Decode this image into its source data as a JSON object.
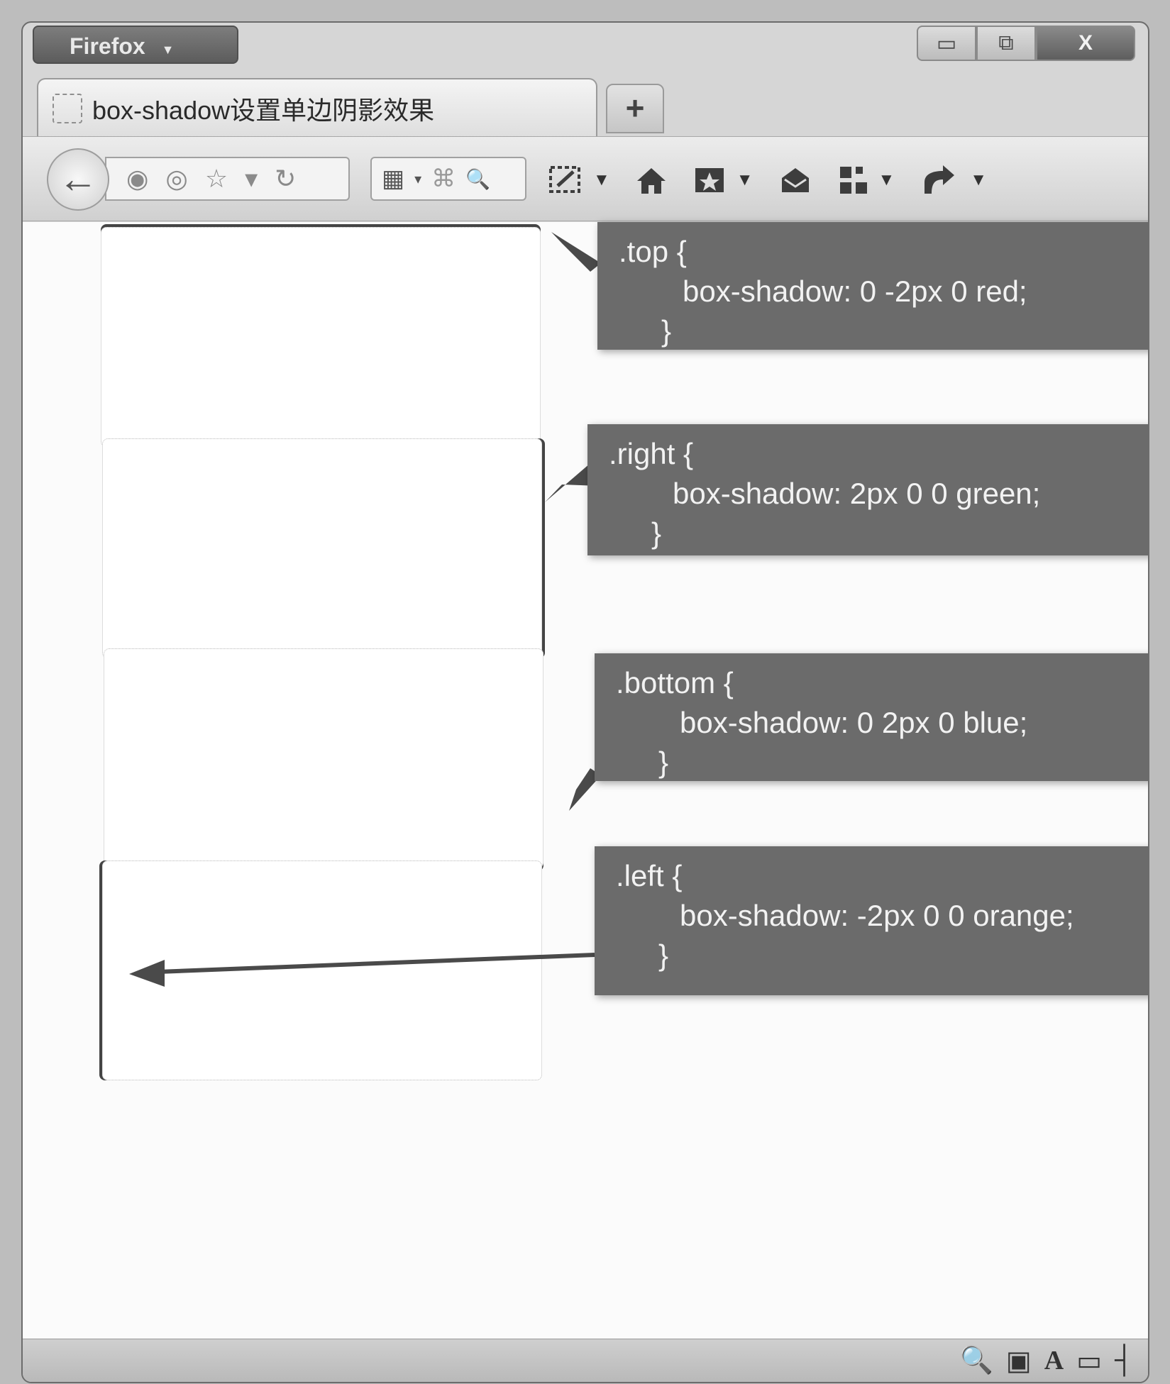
{
  "browser": {
    "menu_label": "Firefox",
    "menu_arrow": "▼",
    "window_controls": {
      "minimize": "▭",
      "restore": "⧉",
      "close": "X"
    }
  },
  "tabs": [
    {
      "title": "box-shadow设置单边阴影效果"
    }
  ],
  "new_tab_label": "+",
  "toolbar": {
    "back_icon": "←",
    "url_icons": [
      "◉",
      "◎",
      "☆",
      "▾",
      "↻"
    ],
    "search_icons": [
      "▦",
      "▾",
      "⌘",
      "🔍"
    ],
    "icons": [
      "screenshot-icon",
      "home-icon",
      "bookmarks-icon",
      "mail-icon",
      "addons-icon",
      "share-icon"
    ]
  },
  "annotations": [
    {
      "selector": ".top {",
      "declaration": "box-shadow: 0 -2px 0 red;",
      "close": "}"
    },
    {
      "selector": ".right {",
      "declaration": "box-shadow: 2px 0 0 green;",
      "close": "}"
    },
    {
      "selector": ".bottom {",
      "declaration": "box-shadow: 0 2px 0 blue;",
      "close": "}"
    },
    {
      "selector": ".left {",
      "declaration": "box-shadow: -2px 0 0 orange;",
      "close": "}"
    }
  ],
  "statusbar_icons": [
    "🔍",
    "▣",
    "A",
    "▭",
    "┤"
  ],
  "colors": {
    "callout_bg": "#6b6b6b",
    "callout_text": "#f2f2f2",
    "page_bg": "#fbfbfb"
  }
}
